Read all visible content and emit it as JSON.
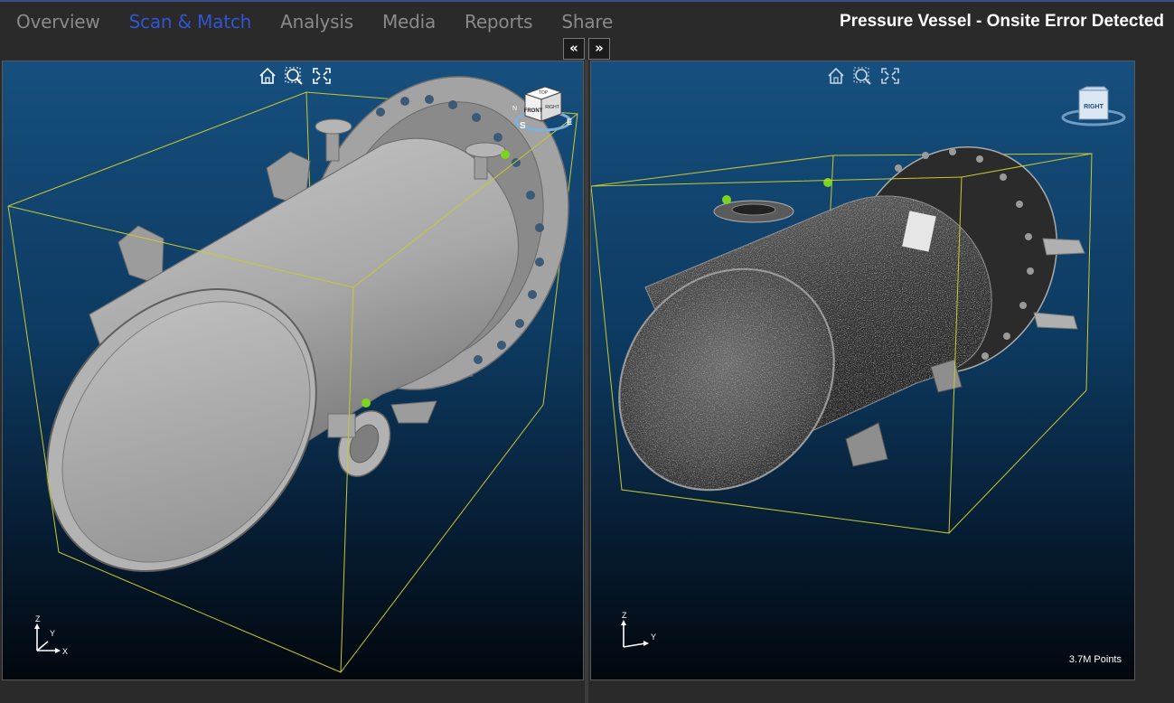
{
  "nav": {
    "tabs": [
      {
        "label": "Overview",
        "active": false
      },
      {
        "label": "Scan & Match",
        "active": true
      },
      {
        "label": "Analysis",
        "active": false
      },
      {
        "label": "Media",
        "active": false
      },
      {
        "label": "Reports",
        "active": false
      },
      {
        "label": "Share",
        "active": false
      }
    ]
  },
  "header": {
    "title": "Pressure Vessel - Onsite Error Detected"
  },
  "panel_controls": {
    "collapse_left": "«",
    "expand_right": "»"
  },
  "left_viewport": {
    "navcube": {
      "face_top": "TOP",
      "face_front": "FRONT",
      "face_side": "RIGHT",
      "compass_s": "S",
      "compass_e": "E",
      "compass_n": "N"
    },
    "axis": {
      "z": "Z",
      "y": "Y",
      "x": "X"
    }
  },
  "right_viewport": {
    "navcube": {
      "face_front": "RIGHT"
    },
    "axis": {
      "z": "Z",
      "y": "Y"
    },
    "points": "3.7M Points"
  },
  "colors": {
    "accent_tab": "#2f55d4",
    "bounding_box": "#c8c832",
    "marker": "#7ed321",
    "bg_top": "#164f7e",
    "bg_bottom": "#02070d"
  }
}
